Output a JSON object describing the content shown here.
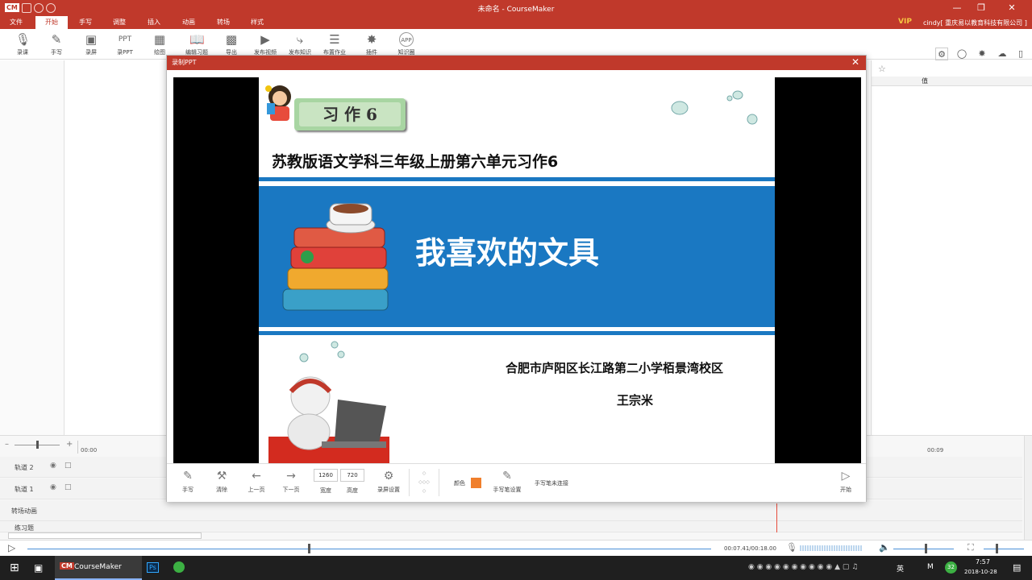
{
  "app": {
    "logo": "CM",
    "window_title": "未命名 - CourseMaker",
    "vip": "VIP",
    "user": "cindy[ 重庆易以教育科技有限公司 ]"
  },
  "menu": {
    "tabs": [
      "文件",
      "开始",
      "手写",
      "调整",
      "插入",
      "动画",
      "转场",
      "样式"
    ],
    "active": "开始"
  },
  "toolbar": {
    "items": [
      {
        "label": "录课",
        "icon": "microphone-icon"
      },
      {
        "label": "手写",
        "icon": "pen-icon"
      },
      {
        "label": "录屏",
        "icon": "screen-record-icon"
      },
      {
        "label": "录PPT",
        "icon": "ppt-icon"
      },
      {
        "label": "绘图",
        "icon": "shapes-icon"
      },
      {
        "label": "编辑习题",
        "icon": "book-icon"
      },
      {
        "label": "导出",
        "icon": "export-icon"
      },
      {
        "label": "发布视频",
        "icon": "play-icon"
      },
      {
        "label": "发布知识",
        "icon": "share-icon"
      },
      {
        "label": "布置作业",
        "icon": "homework-icon"
      },
      {
        "label": "插件",
        "icon": "puzzle-icon"
      },
      {
        "label": "知识圈",
        "icon": "app-icon"
      }
    ]
  },
  "right_panel": {
    "value_header": "值"
  },
  "dialog": {
    "title": "录制PPT",
    "slide": {
      "badge": "习 作 6",
      "heading": "苏教版语文学科三年级上册第六单元习作6",
      "main_title": "我喜欢的文具",
      "school": "合肥市庐阳区长江路第二小学栢景湾校区",
      "author": "王宗米"
    },
    "tools": {
      "handwrite": "手写",
      "clear": "清除",
      "prev": "上一页",
      "next": "下一页",
      "width_value": "1260",
      "width_label": "宽度",
      "height_value": "720",
      "height_label": "高度",
      "record_settings": "录屏设置",
      "color_label": "颜色",
      "pen_settings": "手写笔设置",
      "pen_status": "手写笔未连接",
      "start": "开始"
    },
    "pen_color": "#f07f2c"
  },
  "timeline": {
    "time_left": "00:00",
    "time_right": "00:09",
    "tracks": [
      "轨道 2",
      "轨道 1",
      "转场动画",
      "练习题"
    ]
  },
  "playback": {
    "time": "00:07.41/00:18.00",
    "progress": 0.41
  },
  "taskbar": {
    "app_label": "CourseMaker",
    "app_badge": "CM",
    "ps_badge": "Ps",
    "lang": "英",
    "ime": "M",
    "badge_count": "32",
    "clock_time": "7:57",
    "clock_date": "2018-10-28"
  },
  "colors": {
    "brand": "#c0392b",
    "slide_blue": "#1a78c2"
  }
}
